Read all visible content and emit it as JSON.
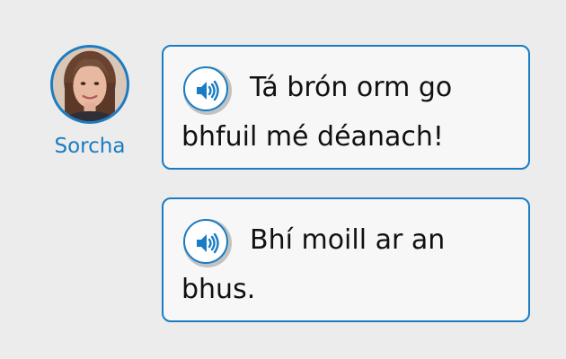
{
  "speaker": {
    "name": "Sorcha",
    "avatar_icon": "speaker-avatar"
  },
  "colors": {
    "accent": "#1a7cc4",
    "bubble_background": "#f7f7f7",
    "page_background": "#ececec",
    "text": "#111111"
  },
  "messages": [
    {
      "text": "Tá brón orm go bhfuil mé déanach!",
      "audio_icon": "speaker-icon"
    },
    {
      "text": "Bhí moill ar an bhus.",
      "audio_icon": "speaker-icon"
    }
  ]
}
